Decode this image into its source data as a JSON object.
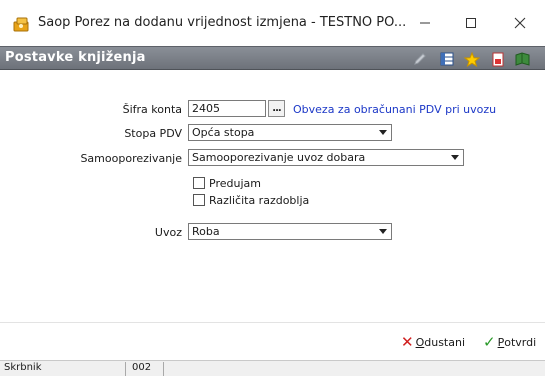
{
  "window": {
    "title": "Saop Porez na dodanu vrijednost izmjena - TESTNO PO...",
    "minimize_icon": "minimize-icon",
    "maximize_icon": "maximize-icon",
    "close_icon": "close-icon"
  },
  "header": {
    "title": "Postavke knjiženja",
    "icons": [
      "edit-icon",
      "columns-icon",
      "favorite-star-icon",
      "document-icon",
      "book-icon"
    ]
  },
  "form": {
    "sifra_konta": {
      "label": "Šifra konta",
      "value": "2405",
      "button": "...",
      "description": "Obveza za obračunani PDV pri uvozu"
    },
    "stopa_pdv": {
      "label": "Stopa PDV",
      "value": "Opća stopa"
    },
    "samooporezivanje": {
      "label": "Samooporezivanje",
      "value": "Samooporezivanje uvoz dobara"
    },
    "predujam": {
      "label": "Predujam",
      "checked": false
    },
    "razlicita_razdoblja": {
      "label": "Različita razdoblja",
      "checked": false
    },
    "uvoz": {
      "label": "Uvoz",
      "value": "Roba"
    }
  },
  "actions": {
    "cancel": {
      "label_first": "O",
      "label_rest": "dustani",
      "icon": "cancel-x-icon"
    },
    "confirm": {
      "label_first": "P",
      "label_rest": "otvrdi",
      "icon": "check-icon"
    }
  },
  "statusbar": {
    "user": "Skrbnik",
    "code": "002"
  },
  "colors": {
    "header_bg": "#7b8088",
    "link": "#1c38c7",
    "cancel": "#d01f1f",
    "confirm": "#2a9a2a"
  }
}
